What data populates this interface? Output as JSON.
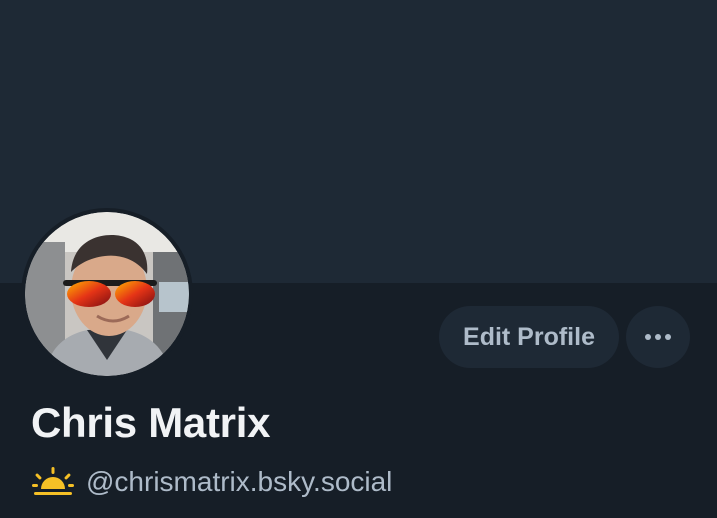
{
  "profile": {
    "display_name": "Chris Matrix",
    "handle": "@chrismatrix.bsky.social",
    "handle_prefix_icon": "sunrise-icon"
  },
  "actions": {
    "edit_label": "Edit Profile",
    "more_icon": "more-options-icon"
  },
  "colors": {
    "background": "#161e27",
    "banner": "#1e2935",
    "button": "#1e2935",
    "muted_text": "#aebbc9",
    "name_text": "#f1f3f5",
    "sun": "#f5c026"
  }
}
